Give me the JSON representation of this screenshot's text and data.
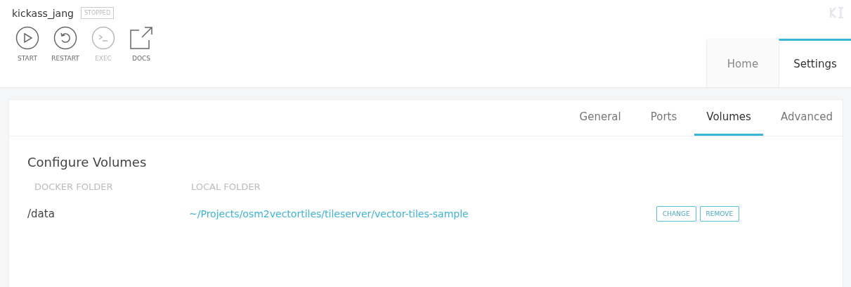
{
  "container": {
    "name": "kickass_jang",
    "status": "STOPPED"
  },
  "actions": [
    {
      "kind": "start",
      "label": "START",
      "disabled": false
    },
    {
      "kind": "restart",
      "label": "RESTART",
      "disabled": false
    },
    {
      "kind": "exec",
      "label": "EXEC",
      "disabled": true
    },
    {
      "kind": "docs",
      "label": "DOCS",
      "disabled": false
    }
  ],
  "tabs": [
    {
      "label": "Home",
      "selected": false
    },
    {
      "label": "Settings",
      "selected": true
    }
  ],
  "subtabs": [
    {
      "label": "General",
      "selected": false
    },
    {
      "label": "Ports",
      "selected": false
    },
    {
      "label": "Volumes",
      "selected": true
    },
    {
      "label": "Advanced",
      "selected": false
    }
  ],
  "section": {
    "title": "Configure Volumes",
    "columns": [
      "DOCKER FOLDER",
      "LOCAL FOLDER"
    ],
    "rows": [
      {
        "docker_folder": "/data",
        "local_folder": "~/Projects/osm2vectortiles/tileserver/vector-tiles-sample",
        "buttons": [
          "CHANGE",
          "REMOVE"
        ]
      }
    ]
  }
}
